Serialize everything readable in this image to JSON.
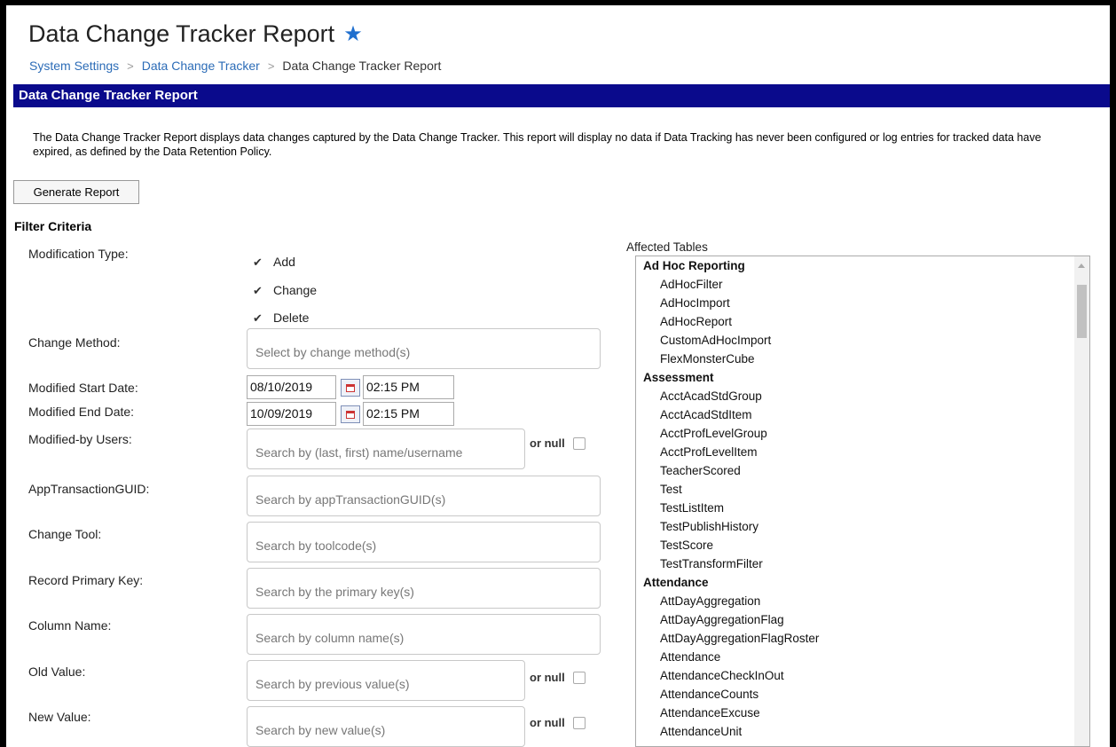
{
  "page": {
    "title": "Data Change Tracker Report",
    "breadcrumb": [
      "System Settings",
      "Data Change Tracker",
      "Data Change Tracker Report"
    ]
  },
  "section": {
    "header": "Data Change Tracker Report",
    "description": "The Data Change Tracker Report displays data changes captured by the Data Change Tracker. This report will display no data if Data Tracking has never been configured or log entries for tracked data have expired, as defined by the Data Retention Policy."
  },
  "generate_button": "Generate Report",
  "filter": {
    "heading": "Filter Criteria",
    "modification_type": {
      "label": "Modification Type:",
      "options": [
        {
          "label": "Add",
          "checked": true
        },
        {
          "label": "Change",
          "checked": true
        },
        {
          "label": "Delete",
          "checked": true
        }
      ]
    },
    "change_method": {
      "label": "Change Method:",
      "placeholder": "Select by change method(s)"
    },
    "start_date": {
      "label": "Modified Start Date:",
      "date": "08/10/2019",
      "time": "02:15 PM"
    },
    "end_date": {
      "label": "Modified End Date:",
      "date": "10/09/2019",
      "time": "02:15 PM"
    },
    "modified_by": {
      "label": "Modified-by Users:",
      "placeholder": "Search by (last, first) name/username",
      "or_null": "or null"
    },
    "guid": {
      "label": "AppTransactionGUID:",
      "placeholder": "Search by appTransactionGUID(s)"
    },
    "tool": {
      "label": "Change Tool:",
      "placeholder": "Search by toolcode(s)"
    },
    "pk": {
      "label": "Record Primary Key:",
      "placeholder": "Search by the primary key(s)"
    },
    "column": {
      "label": "Column Name:",
      "placeholder": "Search by column name(s)"
    },
    "old_value": {
      "label": "Old Value:",
      "placeholder": "Search by previous value(s)",
      "or_null": "or null"
    },
    "new_value": {
      "label": "New Value:",
      "placeholder": "Search by new value(s)",
      "or_null": "or null"
    }
  },
  "affected_tables": {
    "label": "Affected Tables",
    "groups": [
      {
        "name": "Ad Hoc Reporting",
        "items": [
          "AdHocFilter",
          "AdHocImport",
          "AdHocReport",
          "CustomAdHocImport",
          "FlexMonsterCube"
        ]
      },
      {
        "name": "Assessment",
        "items": [
          "AcctAcadStdGroup",
          "AcctAcadStdItem",
          "AcctProfLevelGroup",
          "AcctProfLevelItem",
          "TeacherScored",
          "Test",
          "TestListItem",
          "TestPublishHistory",
          "TestScore",
          "TestTransformFilter"
        ]
      },
      {
        "name": "Attendance",
        "items": [
          "AttDayAggregation",
          "AttDayAggregationFlag",
          "AttDayAggregationFlagRoster",
          "Attendance",
          "AttendanceCheckInOut",
          "AttendanceCounts",
          "AttendanceExcuse",
          "AttendanceUnit"
        ]
      }
    ]
  }
}
